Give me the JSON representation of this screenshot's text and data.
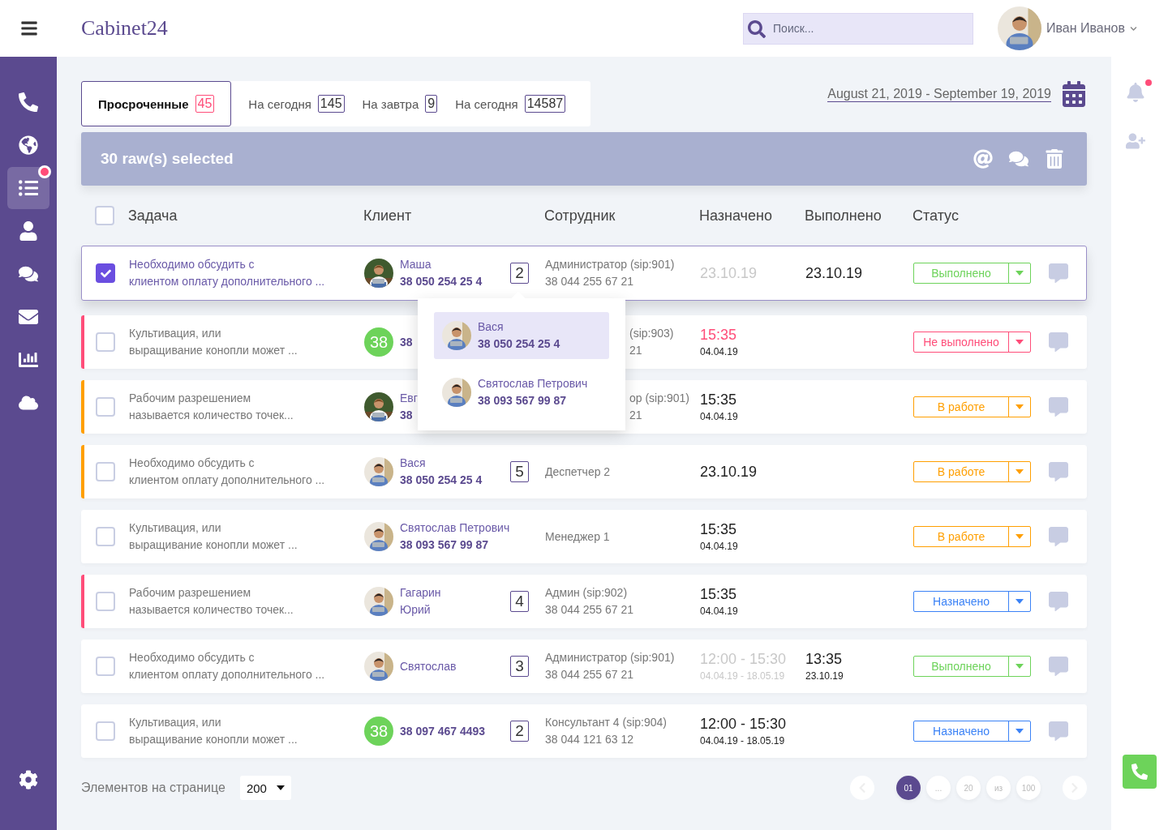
{
  "header": {
    "logo": "Cabinet24",
    "search": {
      "placeholder": "Поиск..."
    },
    "user": {
      "name": "Иван Иванов"
    }
  },
  "sidebar": {
    "items": [
      {
        "kind": "phone",
        "selected": false,
        "alert": false
      },
      {
        "kind": "globe",
        "selected": false,
        "alert": false
      },
      {
        "kind": "list",
        "selected": true,
        "alert": true
      },
      {
        "kind": "user",
        "selected": false,
        "alert": false
      },
      {
        "kind": "chat",
        "selected": false,
        "alert": false
      },
      {
        "kind": "mail",
        "selected": false,
        "alert": false
      },
      {
        "kind": "chart",
        "selected": false,
        "alert": false
      },
      {
        "kind": "cloud",
        "selected": false,
        "alert": false
      }
    ]
  },
  "right_rail": [
    {
      "kind": "bell",
      "alert": true
    },
    {
      "kind": "add-user",
      "alert": false
    }
  ],
  "tabs": [
    {
      "label": "Просроченные",
      "count": "45",
      "selected": true
    },
    {
      "label": "На сегодня",
      "count": "145",
      "selected": false
    },
    {
      "label": "На завтра",
      "count": "9",
      "selected": false
    },
    {
      "label": "На сегодня",
      "count": "14587",
      "selected": false
    }
  ],
  "date_range": "August 21, 2019 - September 19, 2019",
  "selection_bar": {
    "text": "30 raw(s) selected"
  },
  "table": {
    "all_checked": false,
    "columns": [
      "Задача",
      "Клиент",
      "Сотрудник",
      "Назначено",
      "Выполнено",
      "Статус"
    ],
    "rows": [
      {
        "checked": true,
        "task": "Необходимо обсудить с\nклиентом оплату дополнительного ...",
        "client": {
          "avatar": {
            "kind": "woman"
          },
          "name": "Маша",
          "phone": "38 050 254 25 4"
        },
        "count": "2",
        "employee": {
          "name": "Администратор (sip:901)",
          "phone": "38 044 255 67 21"
        },
        "assigned": {
          "main": "23.10.19",
          "kind": "muted"
        },
        "done": {
          "main": "23.10.19"
        },
        "status": {
          "label": "Выполнено",
          "kind": "done"
        },
        "contacts_popup": [
          {
            "name": "Вася",
            "phone": "38 050 254 25 4",
            "selected": true
          },
          {
            "name": "Святослав Петрович",
            "phone": "38 093 567 99 87",
            "selected": false
          }
        ]
      },
      {
        "checked": false,
        "color": "#ff4d79",
        "task": "Культивация, или\nвыращивание конопли может ...",
        "client": {
          "avatar": {
            "kind": "badge",
            "text": "38"
          },
          "phone": "38"
        },
        "employee": {
          "name": "(sip:903)",
          "phone": "21",
          "obscured": true
        },
        "assigned": {
          "main": "15:35",
          "sub": "04.04.19",
          "kind": "overdue"
        },
        "status": {
          "label": "Не выполнено",
          "kind": "failed"
        }
      },
      {
        "checked": false,
        "color": "#ff9f00",
        "task": "Рабочим разрешением\nназывается количество точек...",
        "client": {
          "avatar": {
            "kind": "woman"
          },
          "name": "Евг",
          "phone": "38"
        },
        "employee": {
          "name": "ор (sip:901)",
          "phone": "21",
          "obscured": true
        },
        "assigned": {
          "main": "15:35",
          "sub": "04.04.19",
          "kind": "normal"
        },
        "status": {
          "label": "В работе",
          "kind": "progress"
        }
      },
      {
        "checked": false,
        "color": "#ff9f00",
        "task": "Необходимо обсудить с\nклиентом оплату дополнительного ...",
        "client": {
          "avatar": {
            "kind": "man"
          },
          "name": "Вася",
          "phone": "38 050 254 25 4"
        },
        "count": "5",
        "employee": {
          "name": "Деспетчер 2"
        },
        "assigned": {
          "main": "23.10.19",
          "kind": "normal"
        },
        "status": {
          "label": "В работе",
          "kind": "progress"
        }
      },
      {
        "checked": false,
        "task": "Культивация, или\nвыращивание конопли может ...",
        "client": {
          "avatar": {
            "kind": "man"
          },
          "name": "Святослав Петрович",
          "phone": "38 093 567 99 87"
        },
        "employee": {
          "name": "Менеджер 1"
        },
        "assigned": {
          "main": "15:35",
          "sub": "04.04.19",
          "kind": "normal"
        },
        "status": {
          "label": "В работе",
          "kind": "progress"
        }
      },
      {
        "checked": false,
        "color": "#ff4d79",
        "task": "Рабочим разрешением\nназывается количество точек...",
        "client": {
          "avatar": {
            "kind": "man"
          },
          "name": "Гагарин\nЮрий"
        },
        "count": "4",
        "employee": {
          "name": "Админ (sip:902)",
          "phone": "38 044 255 67 21"
        },
        "assigned": {
          "main": "15:35",
          "sub": "04.04.19",
          "kind": "normal"
        },
        "status": {
          "label": "Назначено",
          "kind": "assigned"
        }
      },
      {
        "checked": false,
        "task": "Необходимо обсудить с\nклиентом оплату дополнительного ...",
        "client": {
          "avatar": {
            "kind": "man"
          },
          "name": "Святослав"
        },
        "count": "3",
        "employee": {
          "name": "Администратор (sip:901)",
          "phone": "38 044 255 67 21"
        },
        "assigned": {
          "main": "12:00 - 15:30",
          "sub": "04.04.19 - 18.05.19",
          "kind": "muted"
        },
        "done": {
          "main": "13:35",
          "sub": "23.10.19"
        },
        "status": {
          "label": "Выполнено",
          "kind": "done"
        }
      },
      {
        "checked": false,
        "task": "Культивация, или\nвыращивание конопли может ...",
        "client": {
          "avatar": {
            "kind": "badge",
            "text": "38"
          },
          "phone": "38 097 467 4493"
        },
        "count": "2",
        "employee": {
          "name": "Консультант 4 (sip:904)",
          "phone": "38 044 121 63 12"
        },
        "assigned": {
          "main": "12:00 - 15:30",
          "sub": "04.04.19 - 18.05.19",
          "kind": "normal"
        },
        "status": {
          "label": "Назначено",
          "kind": "assigned"
        }
      }
    ]
  },
  "footer": {
    "label": "Элементов на странице",
    "page_size": "200",
    "pages": [
      {
        "label": "01",
        "selected": true
      },
      {
        "label": "...",
        "selected": false
      },
      {
        "label": "20",
        "selected": false
      },
      {
        "label": "из",
        "selected": false
      },
      {
        "label": "100",
        "selected": false
      }
    ]
  }
}
